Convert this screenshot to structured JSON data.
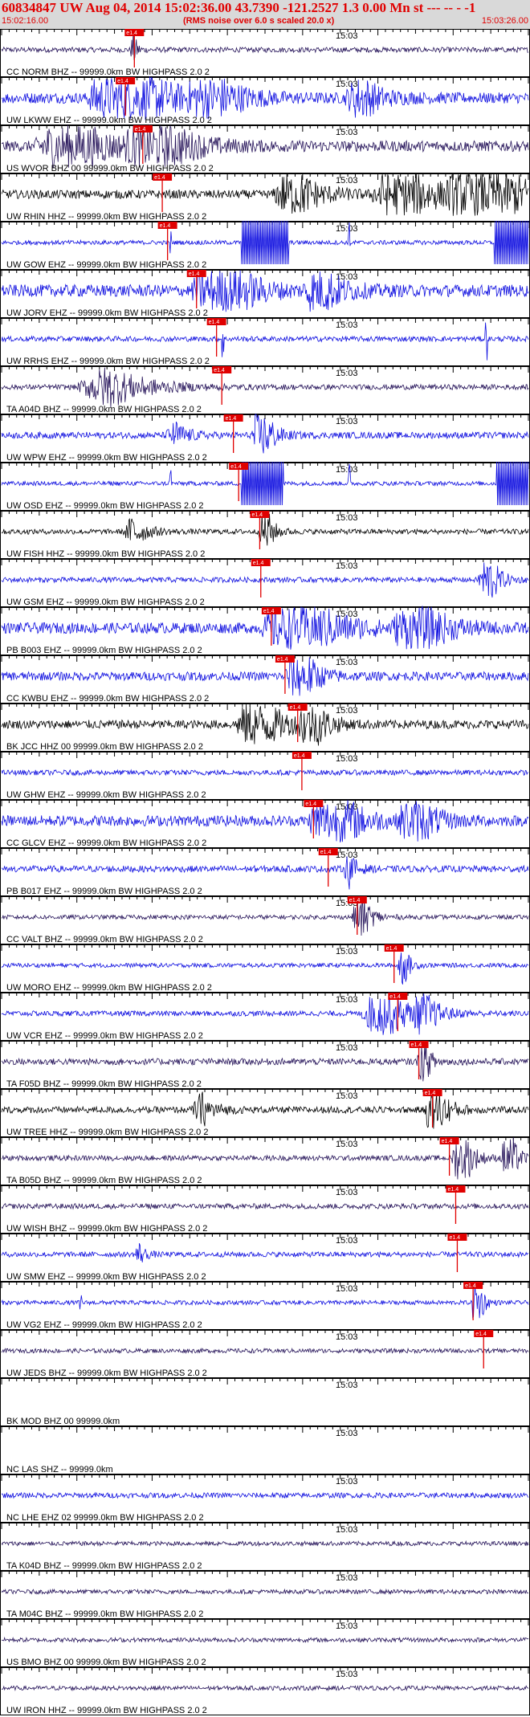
{
  "header": {
    "title": "60834847 UW Aug 04, 2014 15:02:36.00   43.7390 -121.2527  1.3 0.00 Mn st --- -- -  -1",
    "start_time": "15:02:16.00",
    "subtitle": "(RMS noise over 6.0 s scaled 20.0 x)",
    "end_time": "15:03:26.00"
  },
  "minute_label": "15:03",
  "pick_label": "e1.4",
  "colors": {
    "title": "#e00000",
    "blue": "#1010e0",
    "navy": "#26145a",
    "black": "#000000",
    "pick": "#e00000"
  },
  "traces": [
    {
      "label": "CC NORM BHZ -- 99999.0km BW  HIGHPASS  2.0  2",
      "color": "navy",
      "pick": 0.252,
      "amp": 0.12,
      "events": [
        [
          0.25,
          0.9,
          0.3
        ]
      ]
    },
    {
      "label": "UW LKWW EHZ -- 99999.0km BW  HIGHPASS  2.0  2",
      "color": "blue",
      "pick": 0.235,
      "amp": 0.25,
      "events": [
        [
          0.22,
          2.5,
          3.0
        ],
        [
          0.39,
          1.5,
          2.0
        ],
        [
          0.68,
          1.1,
          1.5
        ]
      ]
    },
    {
      "label": "US WVOR BHZ 00 99999.0km BW  HIGHPASS  2.0  2",
      "color": "navy",
      "pick": 0.268,
      "amp": 0.25,
      "events": [
        [
          0.12,
          1.6,
          3.0
        ],
        [
          0.28,
          1.8,
          2.5
        ]
      ]
    },
    {
      "label": "UW RHIN HHZ -- 99999.0km BW  HIGHPASS  2.0  2",
      "color": "black",
      "pick": 0.305,
      "amp": 0.2,
      "events": [
        [
          0.55,
          1.5,
          1.8
        ],
        [
          0.75,
          2.0,
          2.5
        ],
        [
          0.9,
          2.5,
          3.0
        ]
      ]
    },
    {
      "label": "UW GOW EHZ -- 99999.0km BW  HIGHPASS  2.0  2",
      "color": "blue",
      "pick": 0.315,
      "amp": 0.1,
      "clips": [
        [
          0.455,
          0.545
        ],
        [
          0.935,
          1.0
        ]
      ],
      "spikes": [
        0.32,
        0.66
      ]
    },
    {
      "label": "UW JORV EHZ -- 99999.0km BW  HIGHPASS  2.0  2",
      "color": "blue",
      "pick": 0.37,
      "amp": 0.28,
      "events": [
        [
          0.4,
          3.0,
          2.0
        ],
        [
          0.6,
          1.5,
          1.5
        ]
      ]
    },
    {
      "label": "UW RRHS EHZ -- 99999.0km BW  HIGHPASS  2.0  2",
      "color": "blue",
      "pick": 0.408,
      "amp": 0.12,
      "spikes": [
        0.42,
        0.92
      ]
    },
    {
      "label": "TA A04D BHZ -- 99999.0km BW  HIGHPASS  2.0  2",
      "color": "navy",
      "pick": 0.418,
      "amp": 0.12,
      "events": [
        [
          0.2,
          1.0,
          3.0
        ]
      ]
    },
    {
      "label": "UW WPW EHZ -- 99999.0km BW  HIGHPASS  2.0  2",
      "color": "blue",
      "pick": 0.44,
      "amp": 0.15,
      "events": [
        [
          0.49,
          2.2,
          0.8
        ],
        [
          0.33,
          0.6,
          1.0
        ]
      ]
    },
    {
      "label": "UW OSD EHZ -- 99999.0km BW  HIGHPASS  2.0  2",
      "color": "blue",
      "pick": 0.45,
      "amp": 0.1,
      "clips": [
        [
          0.455,
          0.535
        ],
        [
          0.94,
          1.0
        ]
      ],
      "spikes": [
        0.32,
        0.66
      ]
    },
    {
      "label": "UW FISH HHZ -- 99999.0km BW  HIGHPASS  2.0  2",
      "color": "black",
      "pick": 0.49,
      "amp": 0.12,
      "events": [
        [
          0.25,
          0.8,
          1.0
        ],
        [
          0.5,
          1.4,
          0.6
        ]
      ]
    },
    {
      "label": "UW GSM EHZ -- 99999.0km BW  HIGHPASS  2.0  2",
      "color": "blue",
      "pick": 0.492,
      "amp": 0.12,
      "events": [
        [
          0.92,
          1.8,
          0.8
        ]
      ]
    },
    {
      "label": "PB B003 EHZ -- 99999.0km BW  HIGHPASS  2.0  2",
      "color": "blue",
      "pick": 0.512,
      "amp": 0.25,
      "events": [
        [
          0.55,
          2.0,
          3.0
        ],
        [
          0.78,
          1.8,
          2.0
        ]
      ]
    },
    {
      "label": "CC KWBU EHZ -- 99999.0km BW  HIGHPASS  2.0  2",
      "color": "blue",
      "pick": 0.538,
      "amp": 0.2,
      "events": [
        [
          0.56,
          2.0,
          1.2
        ]
      ]
    },
    {
      "label": "BK JCC HHZ 00 99999.0km BW  HIGHPASS  2.0  2",
      "color": "black",
      "pick": 0.562,
      "amp": 0.2,
      "events": [
        [
          0.48,
          1.5,
          2.0
        ],
        [
          0.58,
          2.2,
          1.0
        ]
      ]
    },
    {
      "label": "UW GHW EHZ -- 99999.0km BW  HIGHPASS  2.0  2",
      "color": "blue",
      "pick": 0.57,
      "amp": 0.12,
      "events": []
    },
    {
      "label": "CC GLCV EHZ -- 99999.0km BW  HIGHPASS  2.0  2",
      "color": "blue",
      "pick": 0.592,
      "amp": 0.25,
      "events": [
        [
          0.62,
          2.0,
          2.0
        ],
        [
          0.78,
          1.5,
          1.5
        ]
      ]
    },
    {
      "label": "PB B017 EHZ -- 99999.0km BW  HIGHPASS  2.0  2",
      "color": "blue",
      "pick": 0.62,
      "amp": 0.15,
      "events": [
        [
          0.66,
          0.8,
          0.6
        ]
      ]
    },
    {
      "label": "CC VALT BHZ -- 99999.0km BW  HIGHPASS  2.0  2",
      "color": "navy",
      "pick": 0.675,
      "amp": 0.1,
      "events": [
        [
          0.68,
          1.4,
          0.8
        ]
      ]
    },
    {
      "label": "UW MORO EHZ -- 99999.0km BW  HIGHPASS  2.0  2",
      "color": "blue",
      "pick": 0.745,
      "amp": 0.1,
      "events": [
        [
          0.76,
          1.3,
          0.5
        ]
      ]
    },
    {
      "label": "UW VCR EHZ -- 99999.0km BW  HIGHPASS  2.0  2",
      "color": "blue",
      "pick": 0.752,
      "amp": 0.12,
      "events": [
        [
          0.72,
          1.5,
          2.0
        ],
        [
          0.8,
          1.0,
          1.0
        ]
      ]
    },
    {
      "label": "TA F05D BHZ -- 99999.0km BW  HIGHPASS  2.0  2",
      "color": "navy",
      "pick": 0.792,
      "amp": 0.15,
      "events": [
        [
          0.8,
          1.2,
          0.6
        ]
      ]
    },
    {
      "label": "UW TREE HHZ -- 99999.0km BW  HIGHPASS  2.0  2",
      "color": "black",
      "pick": 0.818,
      "amp": 0.15,
      "events": [
        [
          0.38,
          0.8,
          1.0
        ],
        [
          0.82,
          1.6,
          1.0
        ]
      ]
    },
    {
      "label": "TA B05D BHZ -- 99999.0km BW  HIGHPASS  2.0  2",
      "color": "navy",
      "pick": 0.85,
      "amp": 0.12,
      "events": [
        [
          0.87,
          2.2,
          0.8
        ],
        [
          0.96,
          2.0,
          0.6
        ]
      ]
    },
    {
      "label": "UW WISH BHZ -- 99999.0km BW  HIGHPASS  2.0  2",
      "color": "navy",
      "pick": 0.862,
      "amp": 0.12,
      "events": []
    },
    {
      "label": "UW SMW EHZ -- 99999.0km BW  HIGHPASS  2.0  2",
      "color": "blue",
      "pick": 0.865,
      "amp": 0.12,
      "events": [
        [
          0.26,
          0.6,
          0.5
        ]
      ]
    },
    {
      "label": "UW VG2 EHZ -- 99999.0km BW  HIGHPASS  2.0  2",
      "color": "blue",
      "pick": 0.895,
      "amp": 0.1,
      "events": [
        [
          0.9,
          2.5,
          0.4
        ]
      ],
      "spikes": [
        0.15
      ]
    },
    {
      "label": "UW JEDS BHZ -- 99999.0km BW  HIGHPASS  2.0  2",
      "color": "navy",
      "pick": 0.915,
      "amp": 0.1,
      "events": []
    },
    {
      "label": "BK MOD BHZ 00 99999.0km",
      "color": "navy",
      "pick": null,
      "amp": 0,
      "events": []
    },
    {
      "label": "NC LAS SHZ -- 99999.0km",
      "color": "navy",
      "pick": null,
      "amp": 0,
      "events": []
    },
    {
      "label": "NC LHE EHZ 02 99999.0km BW  HIGHPASS  2.0  2",
      "color": "blue",
      "pick": null,
      "amp": 0.12,
      "events": []
    },
    {
      "label": "TA K04D BHZ -- 99999.0km BW  HIGHPASS  2.0  2",
      "color": "navy",
      "pick": null,
      "amp": 0.1,
      "events": []
    },
    {
      "label": "TA M04C BHZ -- 99999.0km BW  HIGHPASS  2.0  2",
      "color": "navy",
      "pick": null,
      "amp": 0.1,
      "events": []
    },
    {
      "label": "US BMO BHZ 00 99999.0km BW  HIGHPASS  2.0  2",
      "color": "navy",
      "pick": null,
      "amp": 0.1,
      "events": []
    },
    {
      "label": "UW IRON HHZ -- 99999.0km BW  HIGHPASS  2.0  2",
      "color": "navy",
      "pick": null,
      "amp": 0.1,
      "events": []
    }
  ]
}
